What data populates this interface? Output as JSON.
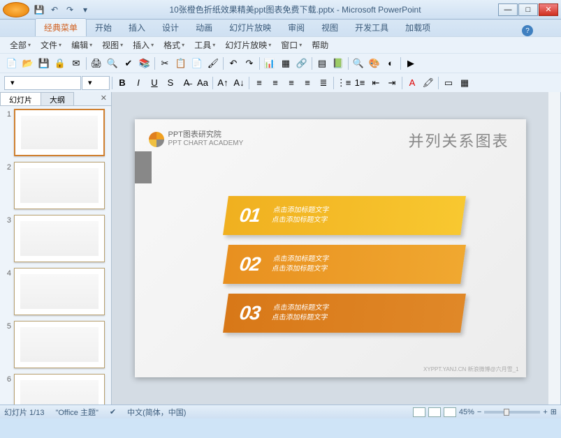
{
  "window": {
    "title": "10张橙色折纸效果精美ppt图表免费下载.pptx - Microsoft PowerPoint"
  },
  "ribbon_tabs": [
    "经典菜单",
    "开始",
    "插入",
    "设计",
    "动画",
    "幻灯片放映",
    "审阅",
    "视图",
    "开发工具",
    "加载项"
  ],
  "menubar": [
    "全部",
    "文件",
    "编辑",
    "视图",
    "插入",
    "格式",
    "工具",
    "幻灯片放映",
    "窗口",
    "帮助"
  ],
  "side_tabs": {
    "slides": "幻灯片",
    "outline": "大纲"
  },
  "slide": {
    "logo_cn": "PPT图表研究院",
    "logo_en": "PPT CHART ACADEMY",
    "title": "并列关系图表",
    "items": [
      {
        "num": "01",
        "line1": "点击添加标题文字",
        "line2": "点击添加标题文字"
      },
      {
        "num": "02",
        "line1": "点击添加标题文字",
        "line2": "点击添加标题文字"
      },
      {
        "num": "03",
        "line1": "点击添加标题文字",
        "line2": "点击添加标题文字"
      }
    ],
    "footer": "XYPPT.YANJ.CN  新浪微博@六月雪_1"
  },
  "status": {
    "slide_indicator": "幻灯片 1/13",
    "theme": "\"Office 主题\"",
    "lang": "中文(简体，中国)",
    "zoom": "45%"
  },
  "thumb_count": 6
}
